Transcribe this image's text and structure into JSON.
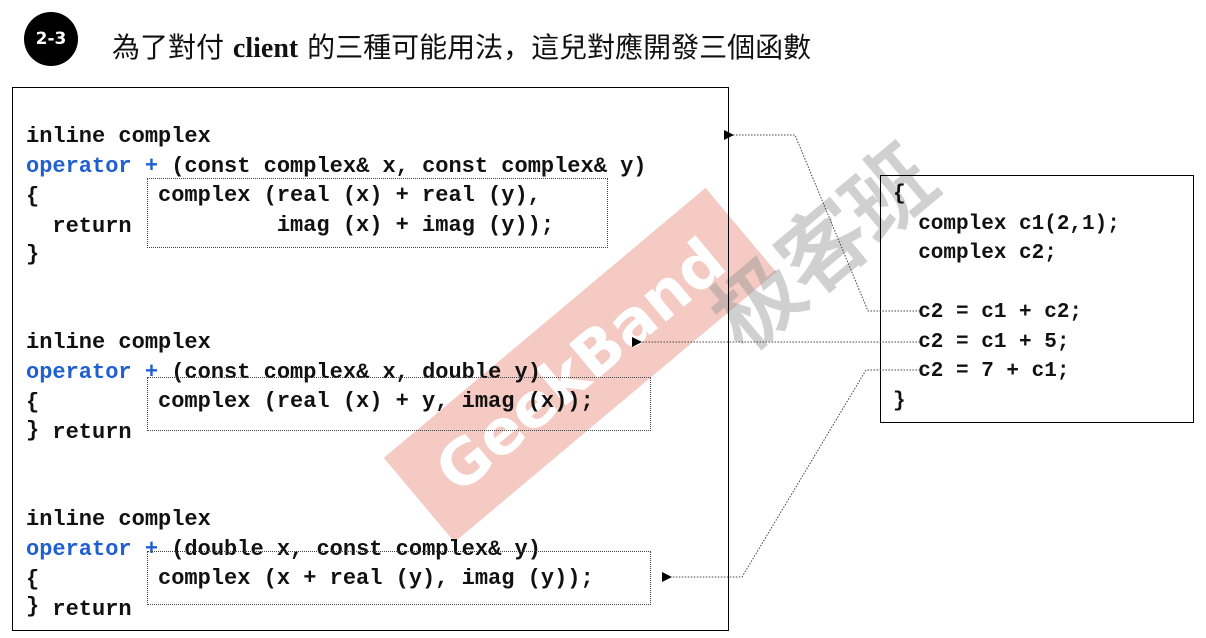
{
  "badge": "2-3",
  "title": {
    "prefix": "為了對付 ",
    "bold": "client",
    "suffix": " 的三種可能用法，這兒對應開發三個函數"
  },
  "functions": [
    {
      "line1": "inline complex",
      "keyword": "operator +",
      "params": " (const complex& x, const complex& y)",
      "open": "{",
      "return_kw": "  return",
      "body1": "complex (real (x) + real (y),",
      "body2": "         imag (x) + imag (y));",
      "close": "}"
    },
    {
      "line1": "inline complex",
      "keyword": "operator +",
      "params": " (const complex& x, double y)",
      "open": "{",
      "return_kw": "  return",
      "body1": "complex (real (x) + y, imag (x));",
      "close": "}"
    },
    {
      "line1": "inline complex",
      "keyword": "operator +",
      "params": " (double x, const complex& y)",
      "open": "{",
      "return_kw": "  return",
      "body1": "complex (x + real (y), imag (y));",
      "close": "}"
    }
  ],
  "client": {
    "open": "{",
    "l1": "  complex c1(2,1);",
    "l2": "  complex c2;",
    "l3": "  c2 = c1 + c2;",
    "l4": "  c2 = c1 + 5;",
    "l5": "  c2 = 7 + c1;",
    "close": "}"
  },
  "watermark": {
    "brand_cn": "极客班",
    "brand_en": "GeekBand"
  },
  "colors": {
    "keyword": "#1f5fd0",
    "watermark": "#e06a55"
  }
}
